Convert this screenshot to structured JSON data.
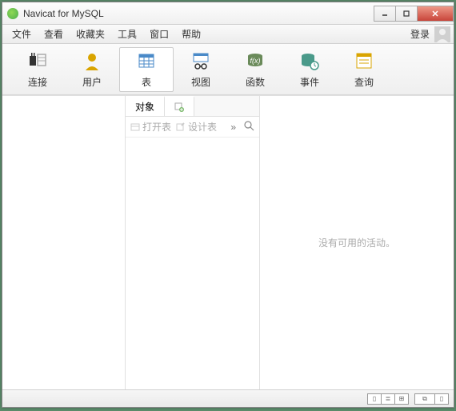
{
  "window": {
    "title": "Navicat for MySQL"
  },
  "menu": {
    "items": [
      "文件",
      "查看",
      "收藏夹",
      "工具",
      "窗口",
      "帮助"
    ],
    "login": "登录"
  },
  "toolbar": {
    "connect": "连接",
    "user": "用户",
    "table": "表",
    "view": "视图",
    "function": "函数",
    "event": "事件",
    "query": "查询"
  },
  "tabs": {
    "objects": "对象"
  },
  "subtoolbar": {
    "open": "打开表",
    "design": "设计表",
    "more": "»"
  },
  "right": {
    "empty": "没有可用的活动。"
  },
  "colors": {
    "accent": "#4caf50",
    "yellow": "#d9a400",
    "teal": "#4a9a8a",
    "cyl": "#6a8a5a"
  }
}
